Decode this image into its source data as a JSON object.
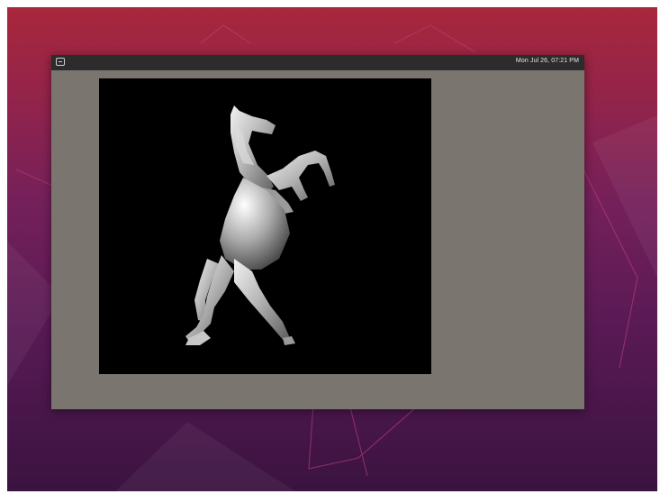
{
  "topbar": {
    "clock": "Mon Jul 26, 07:21 PM",
    "app_icon": "terminal-icon"
  },
  "viewport": {
    "subject": "rearing-horse-model"
  },
  "colors": {
    "desktop_top": "#a8273b",
    "desktop_bottom": "#3a1340",
    "window_bg": "#7a756f",
    "topbar_bg": "#2c2c2c",
    "canvas_bg": "#000000"
  }
}
